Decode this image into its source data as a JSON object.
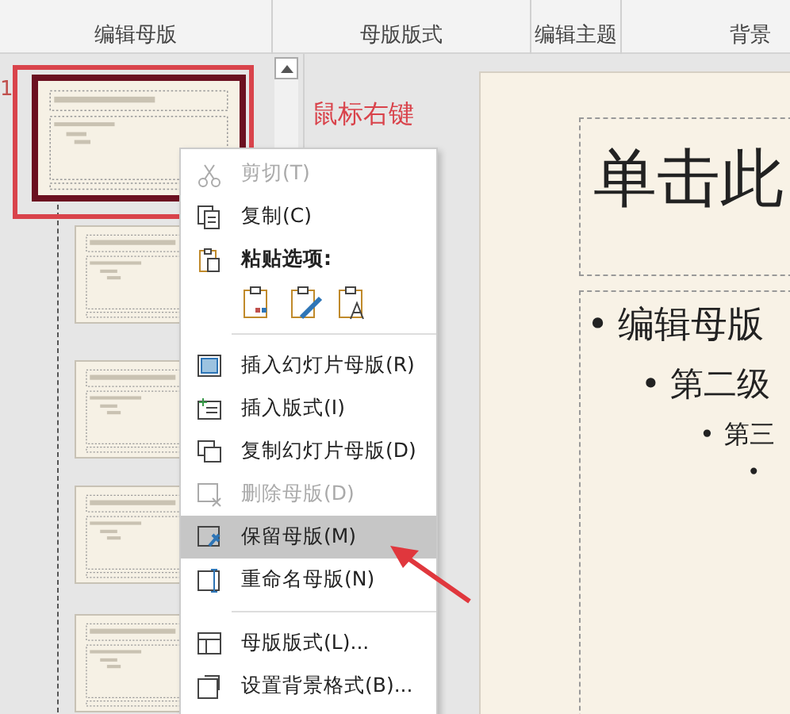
{
  "ribbon": {
    "groups": [
      {
        "label": "编辑母版"
      },
      {
        "label": "母版版式"
      },
      {
        "label": "编辑主题"
      },
      {
        "label": "背景"
      }
    ]
  },
  "thumbnails": [
    {
      "number": "1",
      "selected": true
    },
    {
      "selected": false
    },
    {
      "selected": false
    },
    {
      "selected": false
    },
    {
      "selected": false
    }
  ],
  "annotation": "鼠标右键",
  "slide": {
    "title": "单击此",
    "bullets": [
      {
        "bullet": "•",
        "text": "编辑母版"
      },
      {
        "bullet": "•",
        "text": "第二级"
      },
      {
        "bullet": "•",
        "text": "第三"
      },
      {
        "bullet": "•"
      }
    ]
  },
  "context_menu": [
    {
      "kind": "item",
      "label": "剪切(T)",
      "disabled": true,
      "selected": false
    },
    {
      "kind": "item",
      "label": "复制(C)",
      "disabled": false,
      "selected": false
    },
    {
      "kind": "header",
      "label": "粘贴选项:"
    },
    {
      "kind": "paste"
    },
    {
      "kind": "separator"
    },
    {
      "kind": "item",
      "label": "插入幻灯片母版(R)",
      "disabled": false,
      "selected": false
    },
    {
      "kind": "item",
      "label": "插入版式(I)",
      "disabled": false,
      "selected": false
    },
    {
      "kind": "item",
      "label": "复制幻灯片母版(D)",
      "disabled": false,
      "selected": false
    },
    {
      "kind": "item",
      "label": "删除母版(D)",
      "disabled": true,
      "selected": false
    },
    {
      "kind": "item",
      "label": "保留母版(M)",
      "disabled": false,
      "selected": true
    },
    {
      "kind": "item",
      "label": "重命名母版(N)",
      "disabled": false,
      "selected": false
    },
    {
      "kind": "separator"
    },
    {
      "kind": "item",
      "label": "母版版式(L)...",
      "disabled": false,
      "selected": false
    },
    {
      "kind": "item",
      "label": "设置背景格式(B)...",
      "disabled": false,
      "selected": false
    }
  ]
}
